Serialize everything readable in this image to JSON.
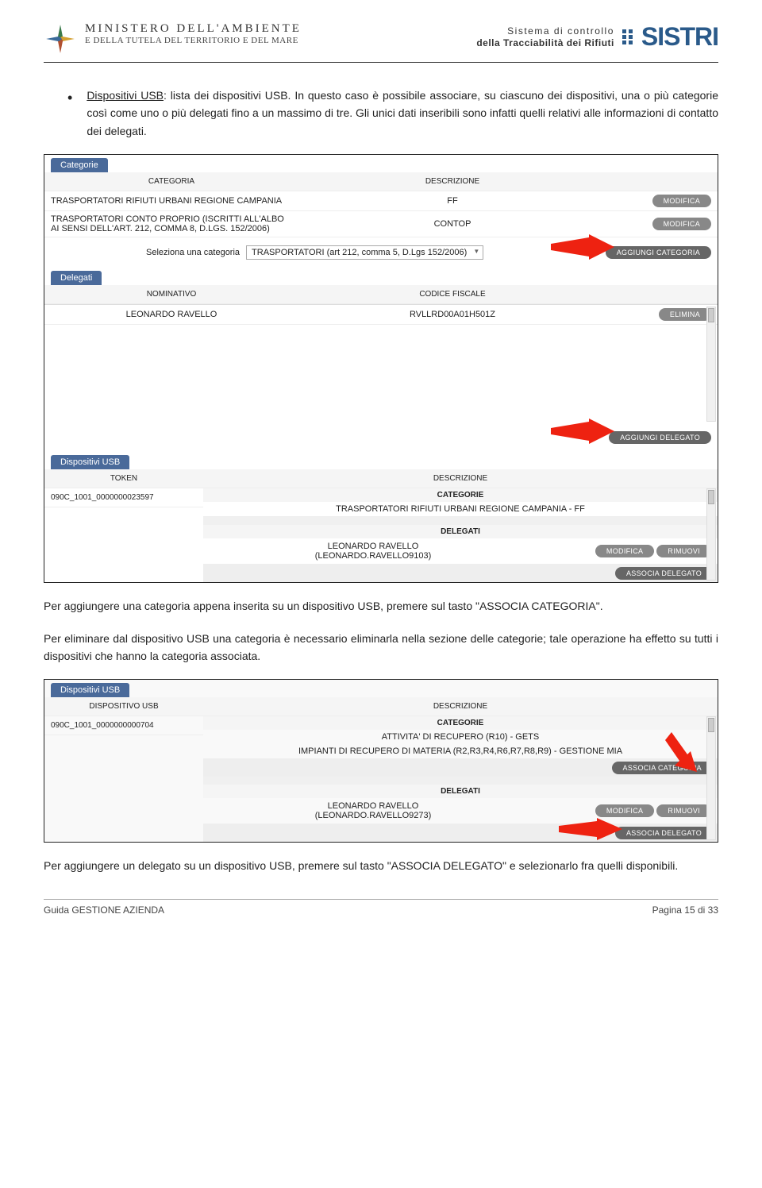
{
  "header": {
    "ministero_line1": "MINISTERO DELL'AMBIENTE",
    "ministero_line2": "E DELLA TUTELA DEL TERRITORIO E DEL MARE",
    "sistri_sub1": "Sistema di controllo",
    "sistri_sub2": "della Tracciabilità dei Rifiuti",
    "sistri_logo": "SISTRI"
  },
  "intro": {
    "bullet_label": "Dispositivi USB",
    "bullet_text": ": lista dei dispositivi USB. In questo caso è possibile associare, su ciascuno dei dispositivi, una o più categorie così come uno o più delegati fino a un massimo di tre. Gli unici dati inseribili sono infatti quelli relativi alle informazioni di contatto dei delegati."
  },
  "shot1": {
    "tab_categorie": "Categorie",
    "hdr_categoria": "CATEGORIA",
    "hdr_descrizione": "DESCRIZIONE",
    "row1": {
      "cat": "TRASPORTATORI RIFIUTI URBANI REGIONE CAMPANIA",
      "desc": "FF",
      "btn": "MODIFICA"
    },
    "row2": {
      "cat": "TRASPORTATORI CONTO PROPRIO (ISCRITTI ALL'ALBO AI SENSI DELL'ART. 212, COMMA 8, D.LGS. 152/2006)",
      "desc": "CONTOP",
      "btn": "MODIFICA"
    },
    "select_label": "Seleziona una categoria",
    "select_value": "TRASPORTATORI (art 212, comma 5, D.Lgs 152/2006)",
    "btn_agg_cat": "AGGIUNGI CATEGORIA",
    "tab_delegati": "Delegati",
    "hdr_nominativo": "NOMINATIVO",
    "hdr_cf": "CODICE FISCALE",
    "del_row": {
      "nome": "LEONARDO RAVELLO",
      "cf": "RVLLRD00A01H501Z",
      "btn": "ELIMINA"
    },
    "btn_agg_del": "AGGIUNGI DELEGATO",
    "tab_usb": "Dispositivi USB",
    "hdr_token": "TOKEN",
    "hdr_desc": "DESCRIZIONE",
    "token": "090C_1001_0000000023597",
    "usb_cat_hdr": "CATEGORIE",
    "usb_cat_val": "TRASPORTATORI RIFIUTI URBANI REGIONE CAMPANIA - FF",
    "usb_del_hdr": "DELEGATI",
    "usb_del_name": "LEONARDO RAVELLO",
    "usb_del_user": "(LEONARDO.RAVELLO9103)",
    "btn_modifica": "MODIFICA",
    "btn_rimuovi": "RIMUOVI",
    "btn_assoc_del": "ASSOCIA DELEGATO"
  },
  "mid_para1": "Per aggiungere una categoria appena inserita su un dispositivo USB, premere sul tasto \"ASSOCIA CATEGORIA\".",
  "mid_para2": "Per eliminare dal dispositivo USB una categoria è necessario eliminarla nella sezione delle categorie; tale operazione ha effetto su tutti i dispositivi che hanno la categoria associata.",
  "shot2": {
    "tab_usb": "Dispositivi USB",
    "hdr_disp": "DISPOSITIVO USB",
    "hdr_desc": "DESCRIZIONE",
    "token": "090C_1001_0000000000704",
    "cat_hdr": "CATEGORIE",
    "cat1": "ATTIVITA' DI RECUPERO (R10) - GETS",
    "cat2": "IMPIANTI DI RECUPERO DI MATERIA (R2,R3,R4,R6,R7,R8,R9) - GESTIONE MIA",
    "btn_assoc_cat": "ASSOCIA CATEGORIA",
    "del_hdr": "DELEGATI",
    "del_name": "LEONARDO RAVELLO",
    "del_user": "(LEONARDO.RAVELLO9273)",
    "btn_modifica": "MODIFICA",
    "btn_rimuovi": "RIMUOVI",
    "btn_assoc_del": "ASSOCIA DELEGATO"
  },
  "last_para": "Per aggiungere un delegato su un dispositivo USB, premere sul tasto \"ASSOCIA DELEGATO\" e selezionarlo fra quelli disponibili.",
  "footer": {
    "left": "Guida GESTIONE AZIENDA",
    "right": "Pagina 15 di 33"
  }
}
